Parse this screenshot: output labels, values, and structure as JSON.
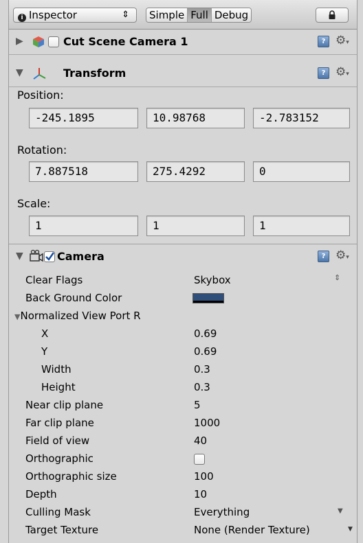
{
  "toolbar": {
    "inspector_label": "Inspector",
    "modes": [
      "Simple",
      "Full",
      "Debug"
    ],
    "active_mode": "Full"
  },
  "object": {
    "name": "Cut Scene Camera 1",
    "enabled": false
  },
  "transform": {
    "title": "Transform",
    "position_label": "Position:",
    "position": [
      "-245.1895",
      "10.98768",
      "-2.783152"
    ],
    "rotation_label": "Rotation:",
    "rotation": [
      "7.887518",
      "275.4292",
      "0"
    ],
    "scale_label": "Scale:",
    "scale": [
      "1",
      "1",
      "1"
    ]
  },
  "camera": {
    "title": "Camera",
    "enabled": true,
    "clear_flags_label": "Clear Flags",
    "clear_flags_value": "Skybox",
    "background_color_label": "Back Ground Color",
    "background_color": "#2f4f7a",
    "viewport_label": "Normalized View Port R",
    "x_label": "X",
    "x_value": "0.69",
    "y_label": "Y",
    "y_value": "0.69",
    "width_label": "Width",
    "width_value": "0.3",
    "height_label": "Height",
    "height_value": "0.3",
    "near_label": "Near clip plane",
    "near_value": "5",
    "far_label": "Far clip plane",
    "far_value": "1000",
    "fov_label": "Field of view",
    "fov_value": "40",
    "ortho_label": "Orthographic",
    "ortho_value": false,
    "ortho_size_label": "Orthographic size",
    "ortho_size_value": "100",
    "depth_label": "Depth",
    "depth_value": "10",
    "culling_label": "Culling Mask",
    "culling_value": "Everything",
    "target_label": "Target Texture",
    "target_value": "None (Render Texture)"
  }
}
